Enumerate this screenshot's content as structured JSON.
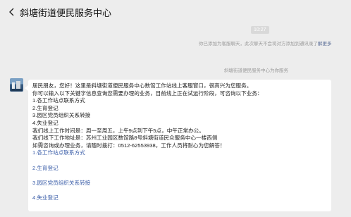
{
  "header": {
    "title": "斜塘街道便民服务中心"
  },
  "chat": {
    "timestamp": "10:27",
    "system_note_text": "你已添加为客服聊天，此次聊天不会将对方添加到通讯录了",
    "system_note_link": "解更多",
    "service_note": "斜塘街道便民服务中心为你服务"
  },
  "message": {
    "lines": [
      "居民朋友，您好！这里是斜塘街道便民服务中心数馆工作站线上客服窗口，很高兴为您服务。",
      "你可以输入以下关键字信息查询您需要办理的业务，目前线上正在试运行阶段，可咨询以下业务：",
      "1.各工作站点联系方式",
      "2.生育登记",
      "3.园区党员组织关系转接",
      "4.失业登记",
      "我们线上工作时间是：周一至周五，上午9点到下午5点，中午正常办公。",
      "我们线下工作地址是：苏州工业园区数馆路8号斜塘街道民众服务中心一楼西侧",
      "如需咨询或办理业务，请随时拨打：0512-62553938，工作人员将耐心为您解答！"
    ],
    "links": [
      "1.各工作站点联系方式",
      "2.生育登记",
      "3.园区党员组织关系转接",
      "4.失业登记"
    ]
  }
}
